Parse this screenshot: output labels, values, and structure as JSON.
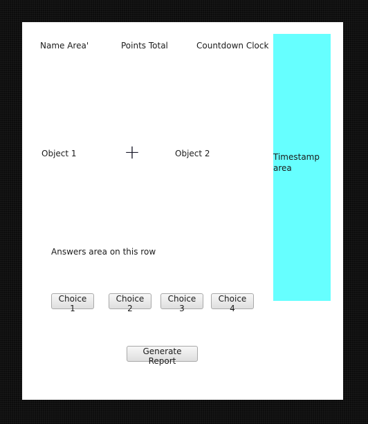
{
  "header": {
    "name_area": "Name Area'",
    "points_total": "Points Total",
    "countdown_clock": "Countdown Clock"
  },
  "timestamp": {
    "label": "Timestamp area",
    "color": "#66ffff"
  },
  "objects": {
    "object1": "Object 1",
    "operator": "+",
    "object2": "Object 2"
  },
  "answers": {
    "label": "Answers area on this row",
    "choices": [
      "Choice 1",
      "Choice 2",
      "Choice 3",
      "Choice 4"
    ]
  },
  "actions": {
    "generate_report": "Generate Report"
  }
}
